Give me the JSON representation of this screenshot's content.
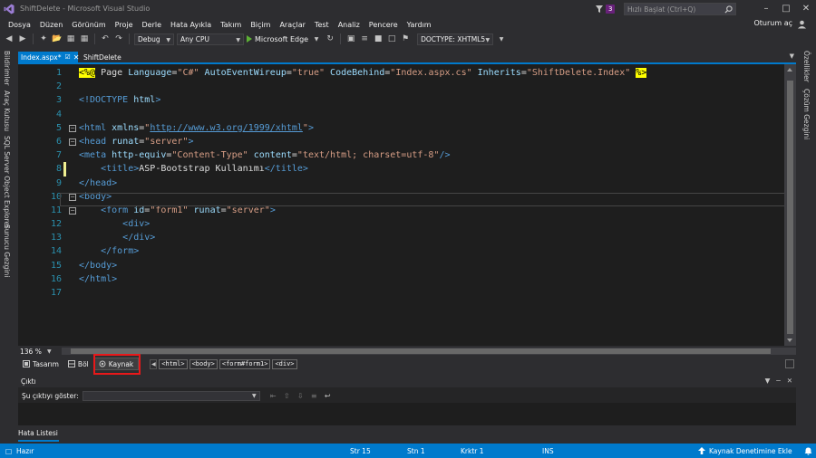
{
  "window": {
    "title": "ShiftDelete - Microsoft Visual Studio",
    "notification_count": "3",
    "quick_launch_placeholder": "Hızlı Başlat (Ctrl+Q)",
    "account_label": "Oturum aç"
  },
  "menu": [
    "Dosya",
    "Düzen",
    "Görünüm",
    "Proje",
    "Derle",
    "Hata Ayıkla",
    "Takım",
    "Biçim",
    "Araçlar",
    "Test",
    "Analiz",
    "Pencere",
    "Yardım"
  ],
  "toolbar": {
    "configuration": "Debug",
    "platform": "Any CPU",
    "run_target": "Microsoft Edge",
    "doctype": "DOCTYPE: XHTML5"
  },
  "left_tool_windows": [
    "Bildirimler",
    "Araç Kutusu",
    "SQL Server Object Explorer",
    "Sunucu Gezgini"
  ],
  "right_tool_windows": [
    "Özellikler",
    "Çözüm Gezgini"
  ],
  "doc_tabs": {
    "active": "Index.aspx*",
    "other": "ShiftDelete"
  },
  "editor": {
    "lines": [
      {
        "n": "1",
        "fold": false,
        "changed": false,
        "tokens": [
          [
            "delim",
            "<%@"
          ],
          [
            "text",
            " "
          ],
          [
            "dir",
            "Page"
          ],
          [
            "text",
            " "
          ],
          [
            "attr",
            "Language"
          ],
          [
            "text",
            "="
          ],
          [
            "str",
            "\"C#\""
          ],
          [
            "text",
            " "
          ],
          [
            "attr",
            "AutoEventWireup"
          ],
          [
            "text",
            "="
          ],
          [
            "str",
            "\"true\""
          ],
          [
            "text",
            " "
          ],
          [
            "attr",
            "CodeBehind"
          ],
          [
            "text",
            "="
          ],
          [
            "str",
            "\"Index.aspx.cs\""
          ],
          [
            "text",
            " "
          ],
          [
            "attr",
            "Inherits"
          ],
          [
            "text",
            "="
          ],
          [
            "str",
            "\"ShiftDelete.Index\""
          ],
          [
            "text",
            " "
          ],
          [
            "delim",
            "%>"
          ]
        ]
      },
      {
        "n": "2",
        "fold": false,
        "changed": false,
        "tokens": []
      },
      {
        "n": "3",
        "fold": false,
        "changed": false,
        "tokens": [
          [
            "tag",
            "<!DOCTYPE "
          ],
          [
            "attr",
            "html"
          ],
          [
            "tag",
            ">"
          ]
        ]
      },
      {
        "n": "4",
        "fold": false,
        "changed": false,
        "tokens": []
      },
      {
        "n": "5",
        "fold": true,
        "changed": false,
        "tokens": [
          [
            "tag",
            "<"
          ],
          [
            "tag",
            "html"
          ],
          [
            "text",
            " "
          ],
          [
            "attr",
            "xmlns"
          ],
          [
            "text",
            "="
          ],
          [
            "str",
            "\""
          ],
          [
            "url",
            "http://www.w3.org/1999/xhtml"
          ],
          [
            "str",
            "\""
          ],
          [
            "tag",
            ">"
          ]
        ]
      },
      {
        "n": "6",
        "fold": true,
        "changed": false,
        "tokens": [
          [
            "tag",
            "<"
          ],
          [
            "tag",
            "head"
          ],
          [
            "text",
            " "
          ],
          [
            "attr",
            "runat"
          ],
          [
            "text",
            "="
          ],
          [
            "str",
            "\"server\""
          ],
          [
            "tag",
            ">"
          ]
        ]
      },
      {
        "n": "7",
        "fold": false,
        "changed": false,
        "tokens": [
          [
            "tag",
            "<"
          ],
          [
            "tag",
            "meta"
          ],
          [
            "text",
            " "
          ],
          [
            "attr",
            "http-equiv"
          ],
          [
            "text",
            "="
          ],
          [
            "str",
            "\"Content-Type\""
          ],
          [
            "text",
            " "
          ],
          [
            "attr",
            "content"
          ],
          [
            "text",
            "="
          ],
          [
            "str",
            "\"text/html; charset=utf-8\""
          ],
          [
            "tag",
            "/>"
          ]
        ]
      },
      {
        "n": "8",
        "fold": false,
        "changed": true,
        "tokens": [
          [
            "text",
            "    "
          ],
          [
            "tag",
            "<"
          ],
          [
            "tag",
            "title"
          ],
          [
            "tag",
            ">"
          ],
          [
            "text",
            "ASP-Bootstrap Kullanımı"
          ],
          [
            "tag",
            "</"
          ],
          [
            "tag",
            "title"
          ],
          [
            "tag",
            ">"
          ]
        ]
      },
      {
        "n": "9",
        "fold": false,
        "changed": false,
        "tokens": [
          [
            "tag",
            "</"
          ],
          [
            "tag",
            "head"
          ],
          [
            "tag",
            ">"
          ]
        ]
      },
      {
        "n": "10",
        "fold": true,
        "changed": false,
        "tokens": [
          [
            "tag",
            "<"
          ],
          [
            "tag",
            "body"
          ],
          [
            "tag",
            ">"
          ]
        ]
      },
      {
        "n": "11",
        "fold": true,
        "changed": false,
        "tokens": [
          [
            "text",
            "    "
          ],
          [
            "tag",
            "<"
          ],
          [
            "tag",
            "form"
          ],
          [
            "text",
            " "
          ],
          [
            "attr",
            "id"
          ],
          [
            "text",
            "="
          ],
          [
            "str",
            "\"form1\""
          ],
          [
            "text",
            " "
          ],
          [
            "attr",
            "runat"
          ],
          [
            "text",
            "="
          ],
          [
            "str",
            "\"server\""
          ],
          [
            "tag",
            ">"
          ]
        ]
      },
      {
        "n": "12",
        "fold": false,
        "changed": false,
        "tokens": [
          [
            "text",
            "        "
          ],
          [
            "tag",
            "<"
          ],
          [
            "tag",
            "div"
          ],
          [
            "tag",
            ">"
          ]
        ]
      },
      {
        "n": "13",
        "fold": false,
        "changed": false,
        "tokens": [
          [
            "text",
            "        "
          ],
          [
            "tag",
            "</"
          ],
          [
            "tag",
            "div"
          ],
          [
            "tag",
            ">"
          ]
        ]
      },
      {
        "n": "14",
        "fold": false,
        "changed": false,
        "tokens": [
          [
            "text",
            "    "
          ],
          [
            "tag",
            "</"
          ],
          [
            "tag",
            "form"
          ],
          [
            "tag",
            ">"
          ]
        ]
      },
      {
        "n": "15",
        "fold": false,
        "changed": false,
        "tokens": [
          [
            "tag",
            "</"
          ],
          [
            "tag",
            "body"
          ],
          [
            "tag",
            ">"
          ]
        ]
      },
      {
        "n": "16",
        "fold": false,
        "changed": false,
        "tokens": [
          [
            "tag",
            "</"
          ],
          [
            "tag",
            "html"
          ],
          [
            "tag",
            ">"
          ]
        ]
      },
      {
        "n": "17",
        "fold": false,
        "changed": false,
        "tokens": []
      }
    ]
  },
  "zoom": "136 %",
  "views": {
    "design": "Tasarım",
    "split": "Böl",
    "source": "Kaynak"
  },
  "breadcrumb": [
    "<html>",
    "<body>",
    "<form#form1>",
    "<div>"
  ],
  "output": {
    "title": "Çıktı",
    "show_from_label": "Şu çıktıyı göster:"
  },
  "error_list_tab": "Hata Listesi",
  "statusbar": {
    "state": "Hazır",
    "line": "Str 15",
    "col": "Stn 1",
    "char": "Krktr 1",
    "mode": "INS",
    "source_control": "Kaynak Denetimine Ekle"
  },
  "colors": {
    "accent": "#007acc",
    "highlight_box": "#e8181a"
  }
}
